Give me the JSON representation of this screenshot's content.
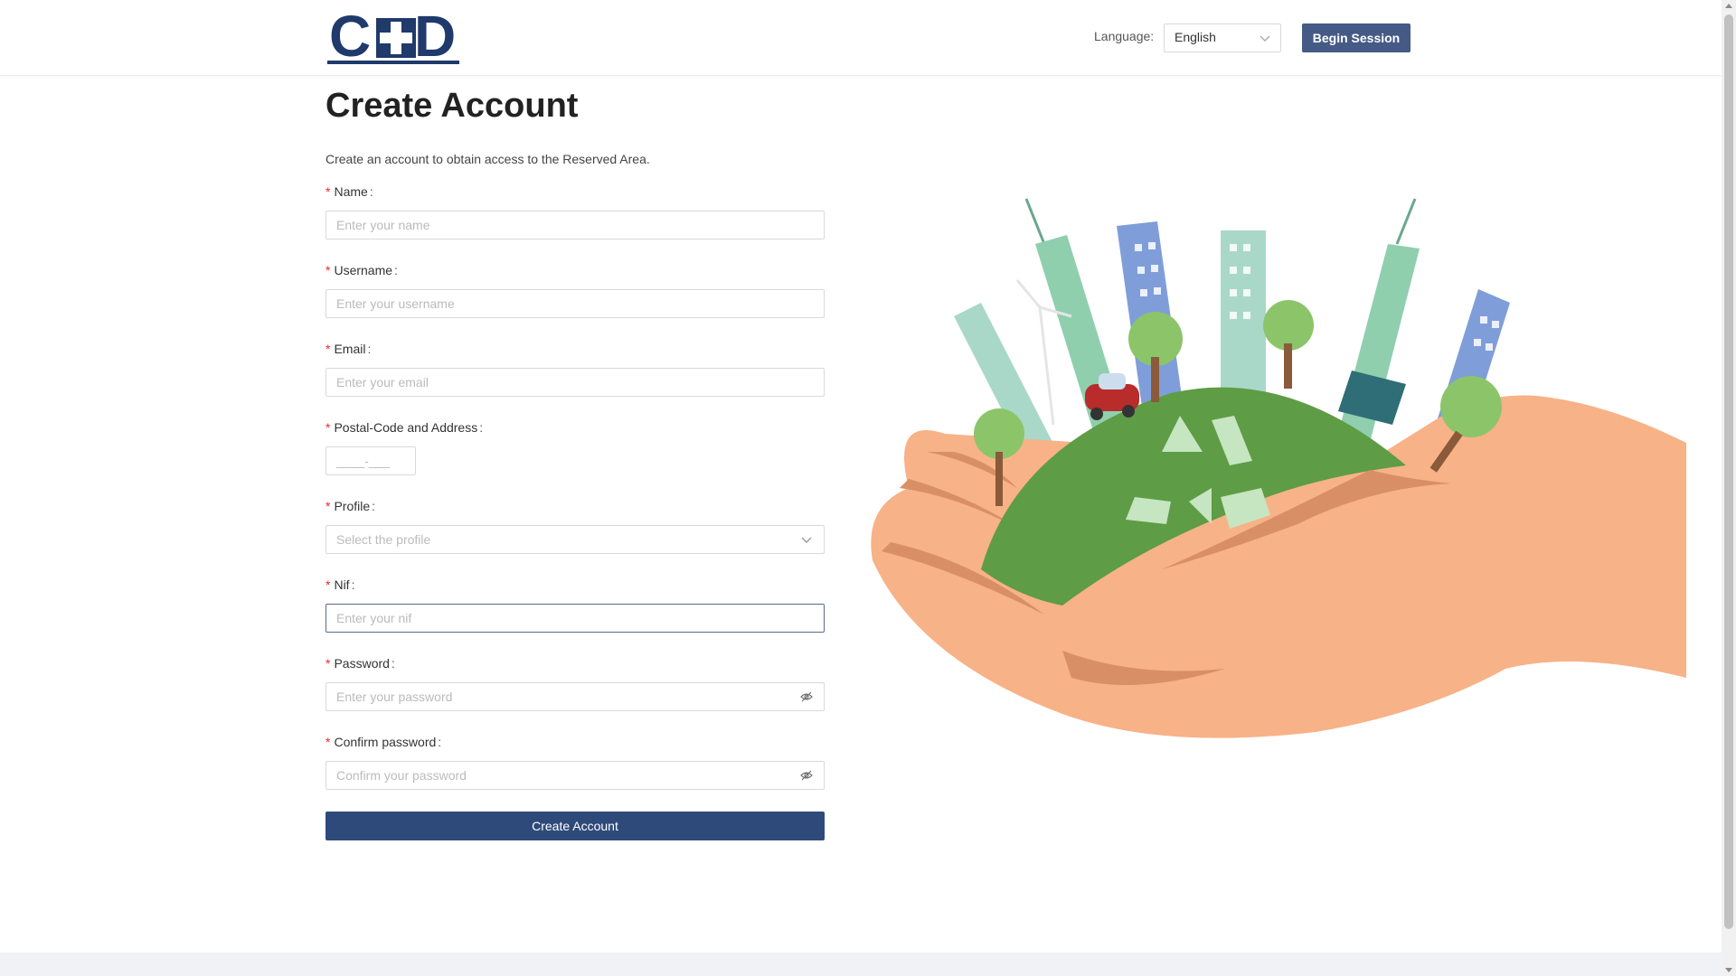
{
  "header": {
    "logo_text": "C+D",
    "language_label": "Language",
    "language_value": "English",
    "begin_session_label": "Begin Session"
  },
  "form": {
    "title": "Create Account",
    "subtitle": "Create an account to obtain access to the Reserved Area.",
    "fields": [
      {
        "label": "Name",
        "placeholder": "Enter your name"
      },
      {
        "label": "Username",
        "placeholder": "Enter your username"
      },
      {
        "label": "Email",
        "placeholder": "Enter your email"
      },
      {
        "label": "Postal-Code and Address",
        "placeholder": "____-___"
      },
      {
        "label": "Profile",
        "placeholder": "Select the profile"
      },
      {
        "label": "Nif",
        "placeholder": "Enter your nif"
      },
      {
        "label": "Password",
        "placeholder": "Enter your password"
      },
      {
        "label": "Confirm password",
        "placeholder": "Confirm your password"
      }
    ],
    "submit_label": "Create Account"
  },
  "colors": {
    "primary": "#2e4a7a",
    "header_button": "#455a85",
    "required": "#e23333"
  },
  "icons": {
    "language_dropdown": "chevron-down-icon",
    "profile_dropdown": "chevron-down-icon",
    "password_toggle": "eye-invisible-icon"
  }
}
